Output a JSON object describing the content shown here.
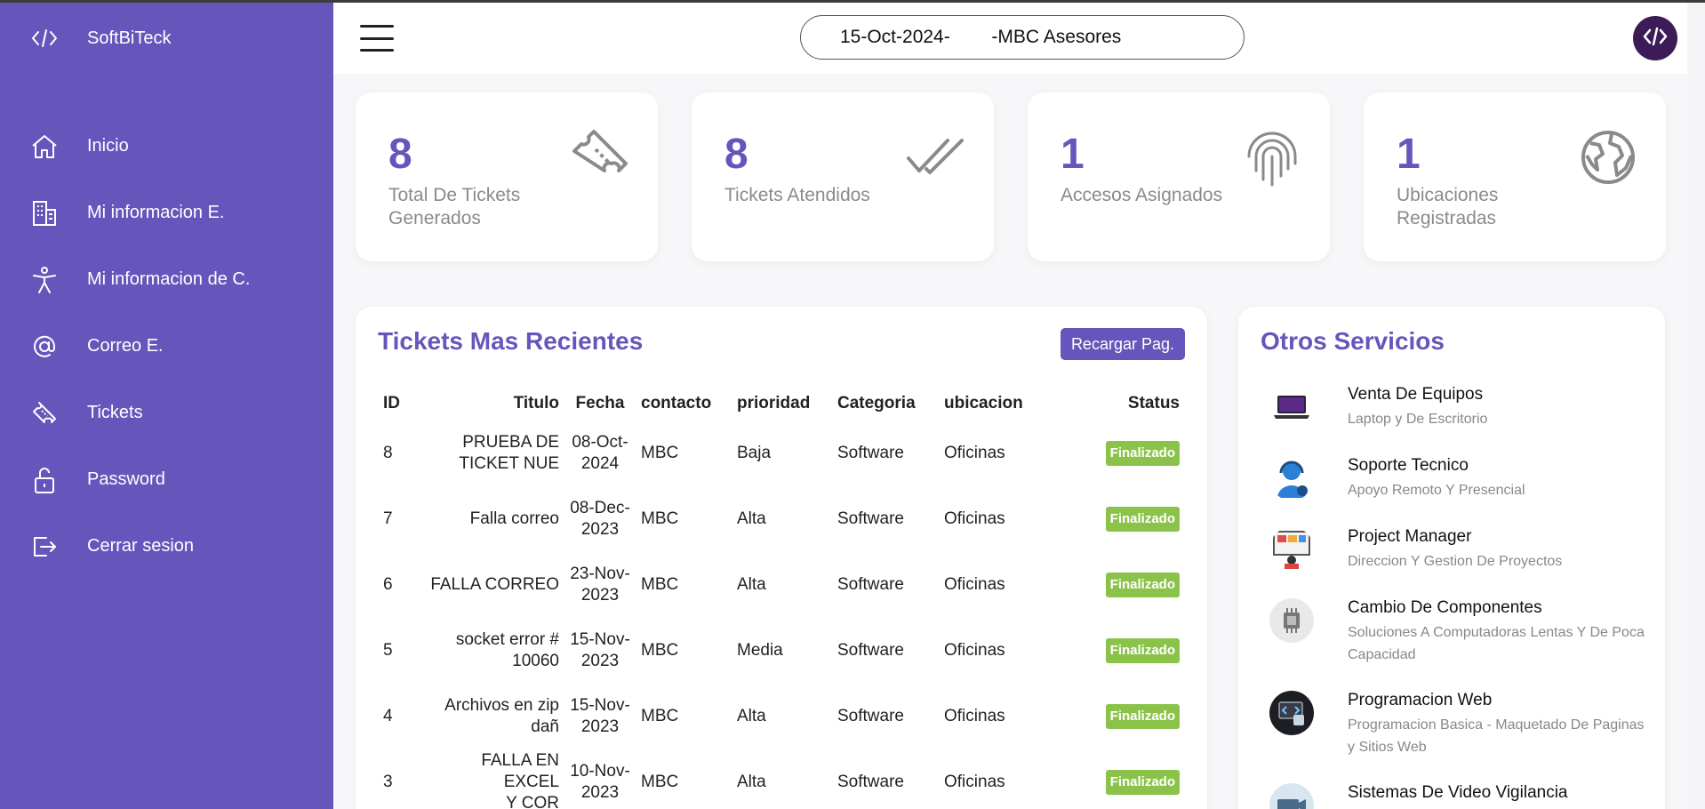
{
  "sidebar": {
    "brand": {
      "name": "SoftBiTeck",
      "icon": "code-icon"
    },
    "items": [
      {
        "label": "Inicio",
        "icon": "home-icon"
      },
      {
        "label": "Mi informacion E.",
        "icon": "building-icon"
      },
      {
        "label": "Mi informacion de C.",
        "icon": "person-icon"
      },
      {
        "label": "Correo E.",
        "icon": "at-icon"
      },
      {
        "label": "Tickets",
        "icon": "ticket-icon"
      },
      {
        "label": "Password",
        "icon": "unlock-icon"
      },
      {
        "label": "Cerrar sesion",
        "icon": "logout-icon"
      }
    ]
  },
  "topbar": {
    "date": "15-Oct-2024-",
    "company": "-MBC Asesores"
  },
  "stats": [
    {
      "value": "8",
      "label": "Total De Tickets Generados",
      "icon": "ticket-icon"
    },
    {
      "value": "8",
      "label": "Tickets Atendidos",
      "icon": "double-check-icon"
    },
    {
      "value": "1",
      "label": "Accesos Asignados",
      "icon": "fingerprint-icon"
    },
    {
      "value": "1",
      "label": "Ubicaciones Registradas",
      "icon": "globe-icon"
    }
  ],
  "tickets": {
    "title": "Tickets Mas Recientes",
    "reload_label": "Recargar Pag.",
    "columns": [
      "ID",
      "Titulo",
      "Fecha",
      "contacto",
      "prioridad",
      "Categoria",
      "ubicacion",
      "Status"
    ],
    "rows": [
      {
        "id": "8",
        "titulo_1": "PRUEBA DE",
        "titulo_2": "TICKET NUE",
        "fecha_1": "08-Oct-",
        "fecha_2": "2024",
        "contacto": "MBC",
        "prioridad": "Baja",
        "categoria": "Software",
        "ubicacion": "Oficinas",
        "status": "Finalizado"
      },
      {
        "id": "7",
        "titulo_1": "Falla correo",
        "titulo_2": "",
        "fecha_1": "08-Dec-",
        "fecha_2": "2023",
        "contacto": "MBC",
        "prioridad": "Alta",
        "categoria": "Software",
        "ubicacion": "Oficinas",
        "status": "Finalizado"
      },
      {
        "id": "6",
        "titulo_1": "FALLA CORREO",
        "titulo_2": "",
        "fecha_1": "23-Nov-",
        "fecha_2": "2023",
        "contacto": "MBC",
        "prioridad": "Alta",
        "categoria": "Software",
        "ubicacion": "Oficinas",
        "status": "Finalizado"
      },
      {
        "id": "5",
        "titulo_1": "socket error #",
        "titulo_2": "10060",
        "fecha_1": "15-Nov-",
        "fecha_2": "2023",
        "contacto": "MBC",
        "prioridad": "Media",
        "categoria": "Software",
        "ubicacion": "Oficinas",
        "status": "Finalizado"
      },
      {
        "id": "4",
        "titulo_1": "Archivos en zip",
        "titulo_2": "dañ",
        "fecha_1": "15-Nov-",
        "fecha_2": "2023",
        "contacto": "MBC",
        "prioridad": "Alta",
        "categoria": "Software",
        "ubicacion": "Oficinas",
        "status": "Finalizado"
      },
      {
        "id": "3",
        "titulo_1": "FALLA EN EXCEL",
        "titulo_2": "Y COR",
        "fecha_1": "10-Nov-",
        "fecha_2": "2023",
        "contacto": "MBC",
        "prioridad": "Alta",
        "categoria": "Software",
        "ubicacion": "Oficinas",
        "status": "Finalizado"
      }
    ]
  },
  "services": {
    "title": "Otros Servicios",
    "items": [
      {
        "name": "Venta De Equipos",
        "desc": "Laptop y De Escritorio",
        "icon": "laptop-icon"
      },
      {
        "name": "Soporte Tecnico",
        "desc": "Apoyo Remoto Y Presencial",
        "icon": "support-agent-icon"
      },
      {
        "name": "Project Manager",
        "desc": "Direccion Y Gestion De Proyectos",
        "icon": "project-board-icon"
      },
      {
        "name": "Cambio De Componentes",
        "desc": "Soluciones A Computadoras Lentas Y De Poca Capacidad",
        "icon": "chip-icon"
      },
      {
        "name": "Programacion Web",
        "desc": "Programacion Basica - Maquetado De Paginas y Sitios Web",
        "icon": "web-dev-icon"
      },
      {
        "name": "Sistemas De Video Vigilancia",
        "desc": "",
        "icon": "camera-icon"
      }
    ]
  },
  "colors": {
    "accent": "#6656bb",
    "success": "#8bc34a",
    "avatar": "#3b1c59"
  }
}
